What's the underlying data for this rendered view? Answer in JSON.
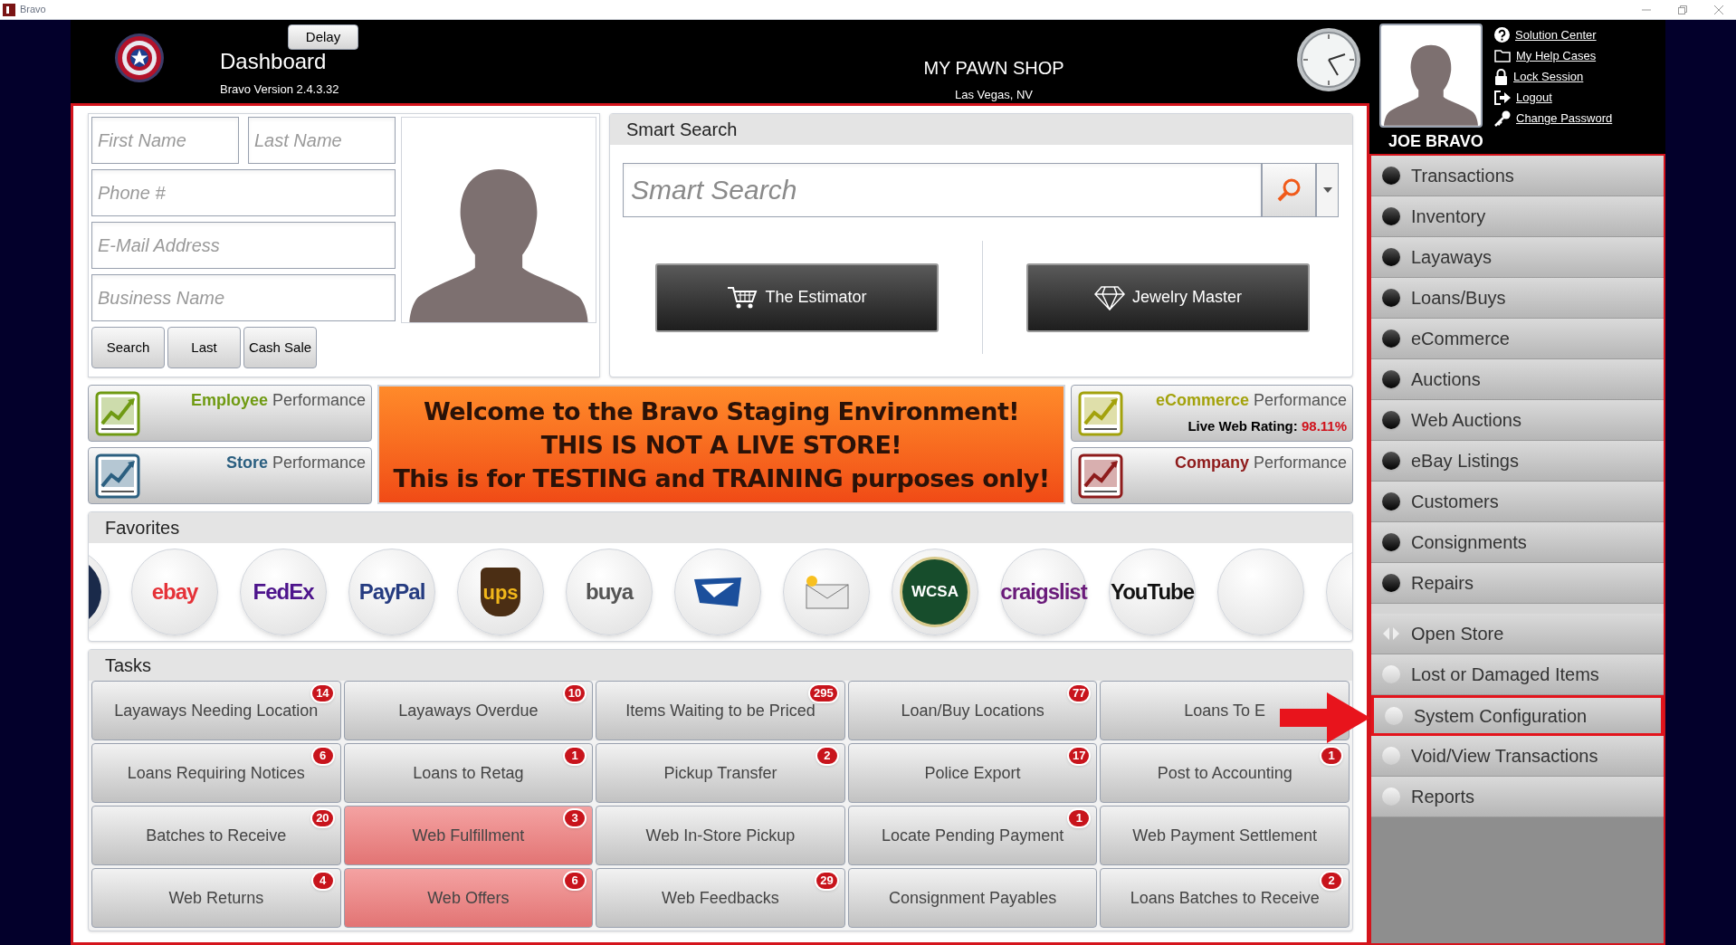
{
  "window": {
    "title": "Bravo"
  },
  "header": {
    "delay_button": "Delay",
    "title": "Dashboard",
    "version": "Bravo Version 2.4.3.32",
    "store_name": "MY PAWN SHOP",
    "store_location": "Las Vegas, NV"
  },
  "user": {
    "name": "JOE BRAVO",
    "links": [
      {
        "label": "Solution Center",
        "kind": "help"
      },
      {
        "label": "My Help Cases",
        "kind": "folder"
      },
      {
        "label": "Lock Session",
        "kind": "lock"
      },
      {
        "label": "Logout",
        "kind": "logout"
      },
      {
        "label": "Change Password",
        "kind": "key"
      }
    ]
  },
  "customer_search": {
    "fields": [
      {
        "placeholder": "First Name"
      },
      {
        "placeholder": "Last Name"
      },
      {
        "placeholder": "Phone #"
      },
      {
        "placeholder": "E-Mail Address"
      },
      {
        "placeholder": "Business Name"
      }
    ],
    "buttons": [
      "Search",
      "Last",
      "Cash Sale"
    ]
  },
  "smart_search": {
    "title": "Smart Search",
    "placeholder": "Smart Search",
    "buttons": [
      {
        "label": "The Estimator",
        "kind": "cart"
      },
      {
        "label": "Jewelry Master",
        "kind": "diamond"
      }
    ]
  },
  "left_tiles": [
    {
      "lead": "Employee",
      "rest": "Performance",
      "color": "#6f9a12"
    },
    {
      "lead": "Store",
      "rest": "Performance",
      "color": "#2b5f80"
    }
  ],
  "banner": {
    "lines": [
      "Welcome to the Bravo Staging Environment!",
      "THIS IS NOT A LIVE STORE!",
      "This is for TESTING and TRAINING purposes only!"
    ]
  },
  "right_tiles": [
    {
      "lead": "eCommerce",
      "rest": "Performance",
      "color": "#a3a20c",
      "rating_label": "Live Web Rating:",
      "rating_value": "98.11%"
    },
    {
      "lead": "Company",
      "rest": "Performance",
      "color": "#8e1b1b"
    }
  ],
  "favorites": {
    "title": "Favorites",
    "items": [
      {
        "kind": "partial"
      },
      {
        "kind": "logo",
        "label": "ebay",
        "color": "#e53238"
      },
      {
        "kind": "logo",
        "label": "FedEx",
        "color": "#4d148c"
      },
      {
        "kind": "logo",
        "label": "PayPal",
        "color": "#253b80"
      },
      {
        "kind": "shield",
        "label": "ups"
      },
      {
        "kind": "logo",
        "label": "buya",
        "color": "#555555"
      },
      {
        "kind": "eagle"
      },
      {
        "kind": "mail"
      },
      {
        "kind": "seal",
        "label": "WCSA"
      },
      {
        "kind": "logo",
        "label": "craigslist",
        "color": "#6a1b7a"
      },
      {
        "kind": "logo",
        "label": "YouTube",
        "color": "#111111"
      },
      {
        "kind": "blank"
      },
      {
        "kind": "partial_right"
      }
    ]
  },
  "tasks": {
    "title": "Tasks",
    "items": [
      {
        "label": "Layaways Needing Location",
        "badge": "14",
        "alert": false
      },
      {
        "label": "Layaways Overdue",
        "badge": "10",
        "alert": false
      },
      {
        "label": "Items Waiting to be Priced",
        "badge": "295",
        "alert": false
      },
      {
        "label": "Loan/Buy Locations",
        "badge": "77",
        "alert": false
      },
      {
        "label": "Loans To E",
        "alert": false
      },
      {
        "label": "Loans Requiring Notices",
        "badge": "6",
        "alert": false
      },
      {
        "label": "Loans to Retag",
        "badge": "1",
        "alert": false
      },
      {
        "label": "Pickup Transfer",
        "badge": "2",
        "alert": false
      },
      {
        "label": "Police Export",
        "badge": "17",
        "alert": false
      },
      {
        "label": "Post to Accounting",
        "badge": "1",
        "alert": false
      },
      {
        "label": "Batches to Receive",
        "badge": "20",
        "alert": false
      },
      {
        "label": "Web Fulfillment",
        "badge": "3",
        "alert": true
      },
      {
        "label": "Web In-Store Pickup",
        "alert": false
      },
      {
        "label": "Locate Pending Payment",
        "badge": "1",
        "alert": false
      },
      {
        "label": "Web Payment Settlement",
        "alert": false
      },
      {
        "label": "Web Returns",
        "badge": "4",
        "alert": false
      },
      {
        "label": "Web Offers",
        "badge": "6",
        "alert": true
      },
      {
        "label": "Web Feedbacks",
        "badge": "29",
        "alert": false
      },
      {
        "label": "Consignment Payables",
        "alert": false
      },
      {
        "label": "Loans Batches to Receive",
        "badge": "2",
        "alert": false
      }
    ]
  },
  "sidebar": {
    "items": [
      {
        "label": "Transactions",
        "kind": "dark",
        "highlighted": false
      },
      {
        "label": "Inventory",
        "kind": "dark",
        "highlighted": false
      },
      {
        "label": "Layaways",
        "kind": "dark",
        "highlighted": false
      },
      {
        "label": "Loans/Buys",
        "kind": "dark",
        "highlighted": false
      },
      {
        "label": "eCommerce",
        "kind": "dark",
        "highlighted": false
      },
      {
        "label": "Auctions",
        "kind": "dark",
        "highlighted": false
      },
      {
        "label": "Web Auctions",
        "kind": "dark",
        "highlighted": false
      },
      {
        "label": "eBay Listings",
        "kind": "dark",
        "highlighted": false
      },
      {
        "label": "Customers",
        "kind": "dark",
        "highlighted": false
      },
      {
        "label": "Consignments",
        "kind": "dark",
        "highlighted": false
      },
      {
        "label": "Repairs",
        "kind": "dark",
        "highlighted": false
      },
      {
        "label": "Open Store",
        "kind": "arrows",
        "highlighted": false
      },
      {
        "label": "Lost or Damaged Items",
        "kind": "light",
        "highlighted": false
      },
      {
        "label": "System Configuration",
        "kind": "light",
        "highlighted": true
      },
      {
        "label": "Void/View Transactions",
        "kind": "light",
        "highlighted": false
      },
      {
        "label": "Reports",
        "kind": "light",
        "highlighted": false
      }
    ]
  }
}
